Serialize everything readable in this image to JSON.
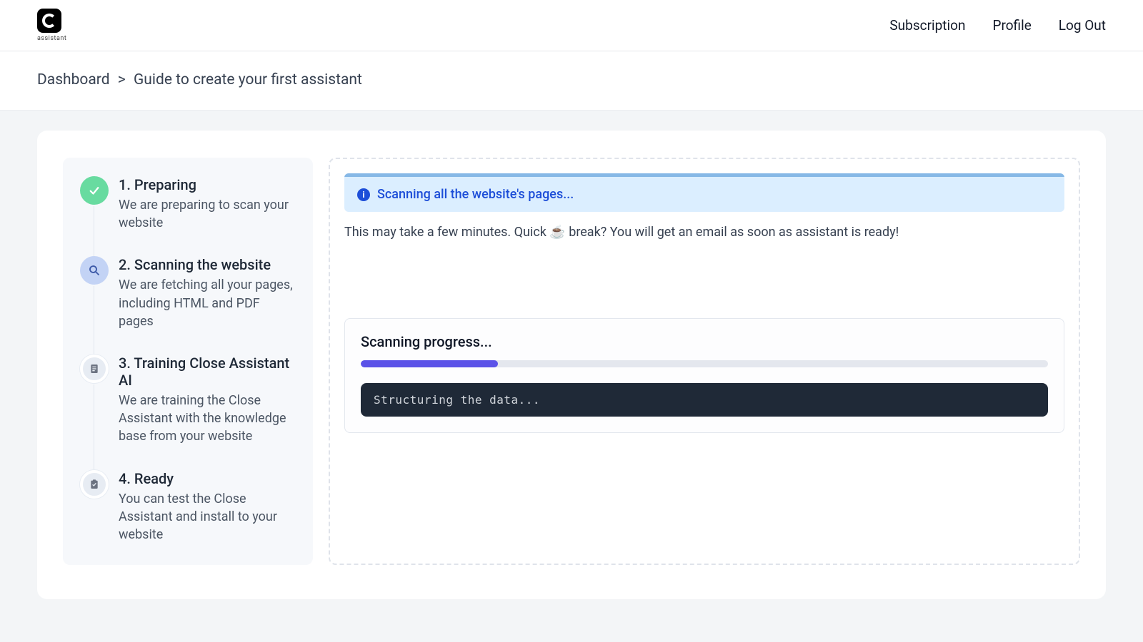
{
  "logo_caption": "assistant",
  "nav": {
    "subscription": "Subscription",
    "profile": "Profile",
    "logout": "Log Out"
  },
  "breadcrumb": {
    "root": "Dashboard",
    "sep": ">",
    "current": "Guide to create your first assistant"
  },
  "steps": [
    {
      "title": "1. Preparing",
      "desc": "We are preparing to scan your website"
    },
    {
      "title": "2. Scanning the website",
      "desc": "We are fetching all your pages, including HTML and PDF pages"
    },
    {
      "title": "3. Training Close Assistant AI",
      "desc": "We are training the Close Assistant with the knowledge base from your website"
    },
    {
      "title": "4. Ready",
      "desc": "You can test the Close Assistant and install to your website"
    }
  ],
  "banner": "Scanning all the website's pages...",
  "note": "This may take a few minutes. Quick ☕ break? You will get an email as soon as assistant is ready!",
  "progress": {
    "label": "Scanning progress...",
    "percent": 20,
    "console": "Structuring the data..."
  }
}
